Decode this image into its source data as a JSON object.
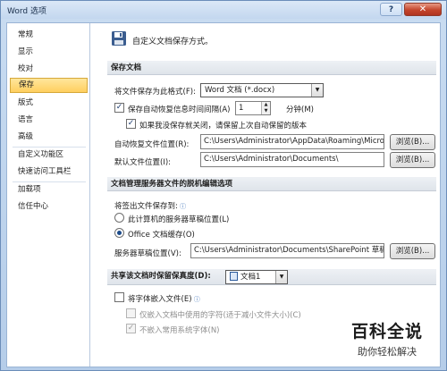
{
  "window": {
    "title": "Word 选项",
    "help_label": "?",
    "close_label": "✕"
  },
  "nav": {
    "items": [
      {
        "label": "常规"
      },
      {
        "label": "显示"
      },
      {
        "label": "校对"
      },
      {
        "label": "保存",
        "active": true
      },
      {
        "label": "版式"
      },
      {
        "label": "语言"
      },
      {
        "label": "高级"
      },
      {
        "label": "自定义功能区"
      },
      {
        "label": "快速访问工具栏"
      },
      {
        "label": "加载项"
      },
      {
        "label": "信任中心"
      }
    ]
  },
  "header": {
    "icon": "floppy-disk-icon",
    "text": "自定义文档保存方式。"
  },
  "save_docs": {
    "title": "保存文档",
    "format_label": "将文件保存为此格式(F):",
    "format_value": "Word 文档 (*.docx)",
    "autorecover_label": "保存自动恢复信息时间间隔(A)",
    "autorecover_checked": true,
    "autorecover_minutes": "1",
    "minutes_label": "分钟(M)",
    "keep_last_label": "如果我没保存就关闭，请保留上次自动保留的版本",
    "keep_last_checked": true,
    "autorecover_location_label": "自动恢复文件位置(R):",
    "autorecover_location_value": "C:\\Users\\Administrator\\AppData\\Roaming\\Micro",
    "default_location_label": "默认文件位置(I):",
    "default_location_value": "C:\\Users\\Administrator\\Documents\\",
    "browse_label": "浏览(B)..."
  },
  "offline": {
    "title": "文档管理服务器文件的脱机编辑选项",
    "checkout_label": "将签出文件保存到:",
    "option_server": "此计算机的服务器草稿位置(L)",
    "option_cache": "Office 文档缓存(O)",
    "cache_selected": true,
    "drafts_label": "服务器草稿位置(V):",
    "drafts_value": "C:\\Users\\Administrator\\Documents\\SharePoint 草稿\\",
    "browse_label": "浏览(B)..."
  },
  "fidelity": {
    "title": "共享该文档时保留保真度(D):",
    "document_value": "文档1",
    "embed_fonts_label": "将字体嵌入文件(E)",
    "embed_fonts_checked": false,
    "embed_used_label": "仅嵌入文档中使用的字符(适于减小文件大小)(C)",
    "no_common_label": "不嵌入常用系统字体(N)",
    "no_common_checked": true
  },
  "watermark": {
    "big": "百科全说",
    "small": "助你轻松解决"
  }
}
